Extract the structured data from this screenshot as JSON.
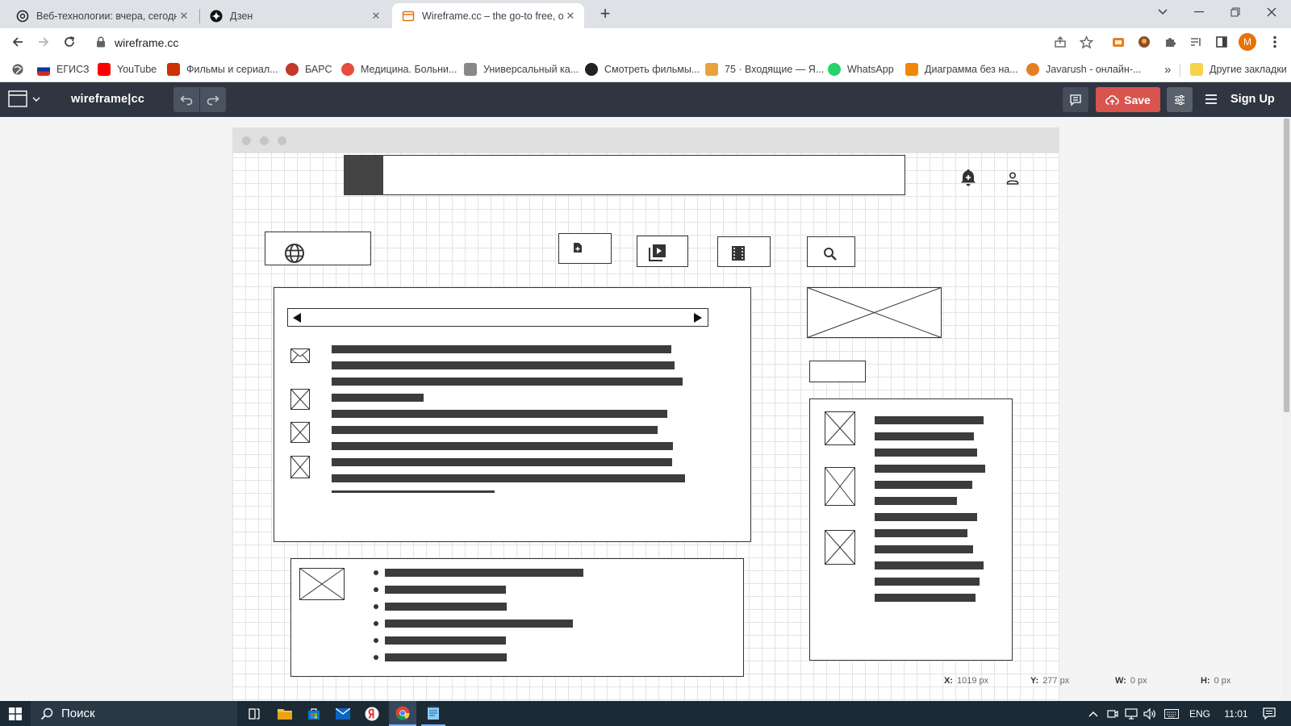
{
  "browser": {
    "tabs": [
      {
        "title": "Веб-технологии: вчера, сегодня",
        "active": false,
        "icon": "openai-icon"
      },
      {
        "title": "Дзен",
        "active": false,
        "icon": "dzen-icon"
      },
      {
        "title": "Wireframe.cc – the go-to free, on",
        "active": true,
        "icon": "wireframe-icon"
      }
    ],
    "new_tab": "+",
    "url": "wireframe.cc",
    "profile_initial": "M",
    "bookmarks": [
      {
        "label": "ЕГИСЗ",
        "icon_color": "#d52b1e"
      },
      {
        "label": "YouTube",
        "icon_color": "#ff0000"
      },
      {
        "label": "Фильмы и сериал...",
        "icon_color": "#cc3300"
      },
      {
        "label": "БАРС",
        "icon_color": "#c0392b"
      },
      {
        "label": "Медицина. Больни...",
        "icon_color": "#e74c3c"
      },
      {
        "label": "Универсальный ка...",
        "icon_color": "#888888"
      },
      {
        "label": "Смотреть фильмы...",
        "icon_color": "#222222"
      },
      {
        "label": "75 · Входящие — Я...",
        "icon_color": "#e8a33d"
      },
      {
        "label": "WhatsApp",
        "icon_color": "#25d366"
      },
      {
        "label": "Диаграмма без на...",
        "icon_color": "#f08705"
      },
      {
        "label": "Javarush - онлайн-...",
        "icon_color": "#e67e22"
      }
    ],
    "more_bookmarks": "»",
    "other_bookmarks": "Другие закладки"
  },
  "app": {
    "logo": "wireframe|cc",
    "save_label": "Save",
    "signup_label": "Sign Up"
  },
  "status": {
    "x_label": "X:",
    "x_value": "1019 px",
    "y_label": "Y:",
    "y_value": "277 px",
    "w_label": "W:",
    "w_value": "0 px",
    "h_label": "H:",
    "h_value": "0 px"
  },
  "taskbar": {
    "search_label": "Поиск",
    "lang": "ENG",
    "time": "11:01"
  },
  "colors": {
    "app_bar": "#2f3541",
    "save_button": "#d9534f",
    "wireframe_ink": "#333333"
  }
}
